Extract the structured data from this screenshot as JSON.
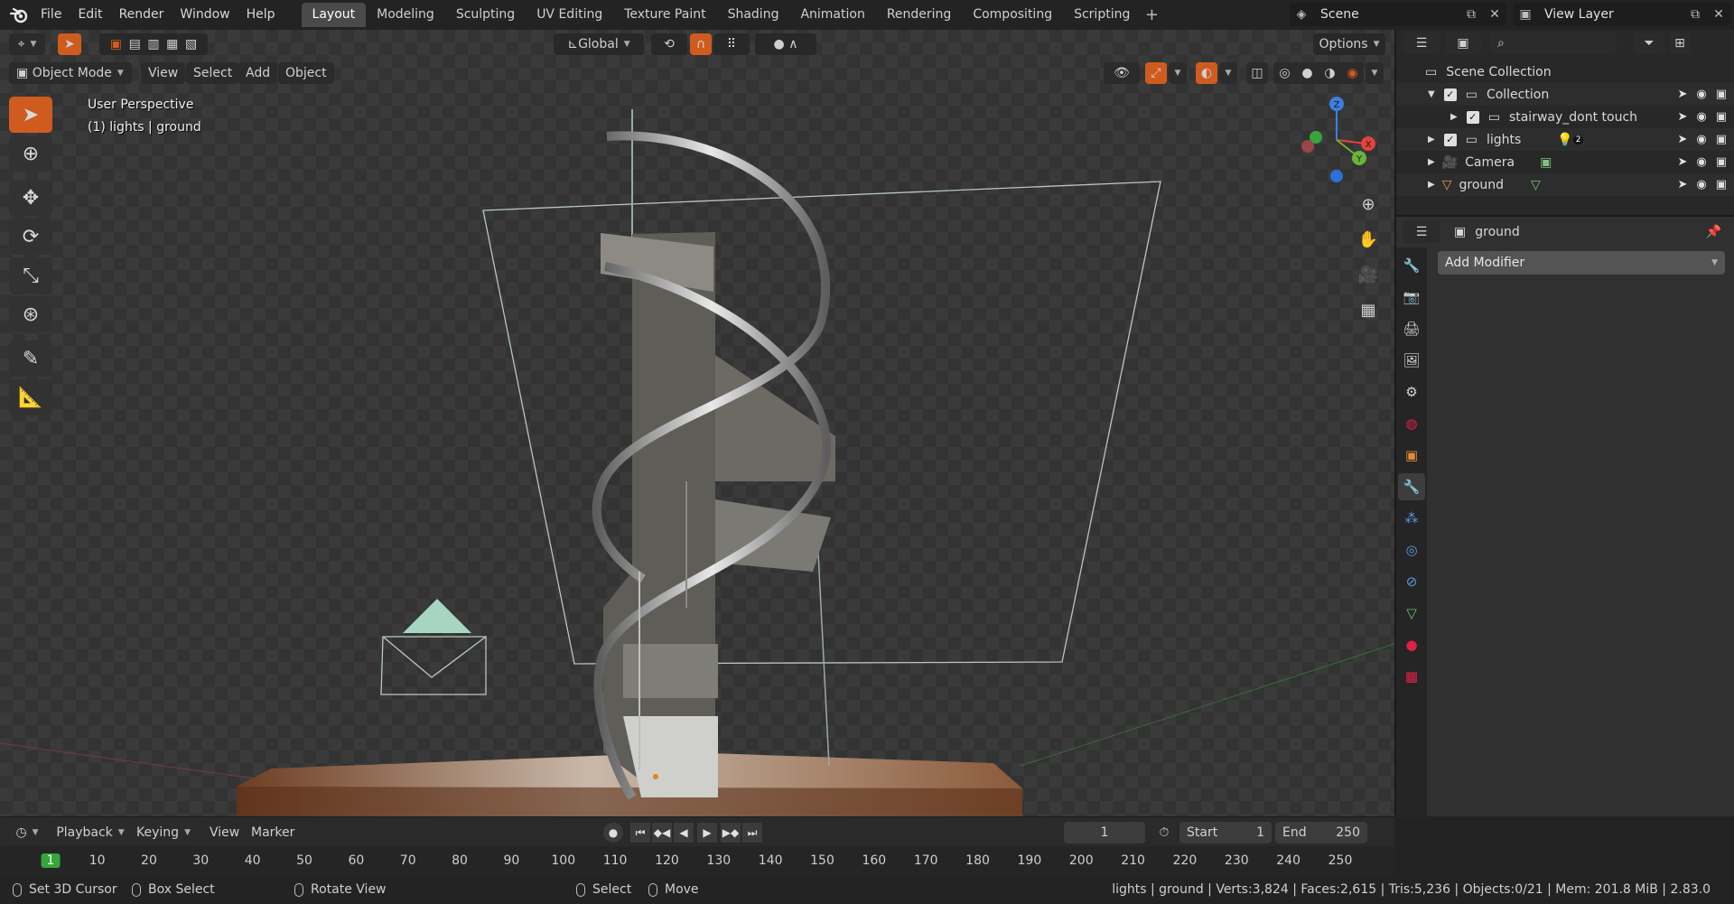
{
  "menubar": {
    "items": [
      "File",
      "Edit",
      "Render",
      "Window",
      "Help"
    ],
    "workspaces": [
      "Layout",
      "Modeling",
      "Sculpting",
      "UV Editing",
      "Texture Paint",
      "Shading",
      "Animation",
      "Rendering",
      "Compositing",
      "Scripting"
    ],
    "active_workspace": "Layout",
    "add_tab": "+",
    "scene_name": "Scene",
    "view_layer_name": "View Layer"
  },
  "viewport_header": {
    "mode": "Object Mode",
    "menus": [
      "View",
      "Select",
      "Add",
      "Object"
    ],
    "transform_orientation": "Global",
    "options_label": "Options"
  },
  "viewport": {
    "perspective_label": "User Perspective",
    "context_label": "(1) lights | ground",
    "gizmo_axes": {
      "x": "X",
      "y": "Y",
      "z": "Z"
    }
  },
  "outliner": {
    "rows": [
      {
        "label": "Scene Collection"
      },
      {
        "label": "Collection"
      },
      {
        "label": "stairway_dont touch"
      },
      {
        "label": "lights",
        "badge": "2"
      },
      {
        "label": "Camera"
      },
      {
        "label": "ground"
      }
    ]
  },
  "properties": {
    "object_name": "ground",
    "add_modifier_label": "Add Modifier"
  },
  "timeline": {
    "menus": [
      "Playback",
      "Keying",
      "View",
      "Marker"
    ],
    "current_frame": "1",
    "start_label": "Start",
    "start_value": "1",
    "end_label": "End",
    "end_value": "250",
    "ruler_ticks": [
      "1",
      "10",
      "20",
      "30",
      "40",
      "50",
      "60",
      "70",
      "80",
      "90",
      "100",
      "110",
      "120",
      "130",
      "140",
      "150",
      "160",
      "170",
      "180",
      "190",
      "200",
      "210",
      "220",
      "230",
      "240",
      "250"
    ]
  },
  "statusbar": {
    "hints": [
      "Set 3D Cursor",
      "Box Select",
      "Rotate View",
      "Select",
      "Move"
    ],
    "stats": "lights | ground | Verts:3,824 | Faces:2,615 | Tris:5,236 | Objects:0/21 | Mem: 201.8 MiB | 2.83.0"
  },
  "colors": {
    "accent_orange": "#cf5b1f",
    "frame_green": "#35a63a",
    "axis_x": "#e0443d",
    "axis_y": "#6bb33a",
    "axis_z": "#3f7fdc"
  }
}
